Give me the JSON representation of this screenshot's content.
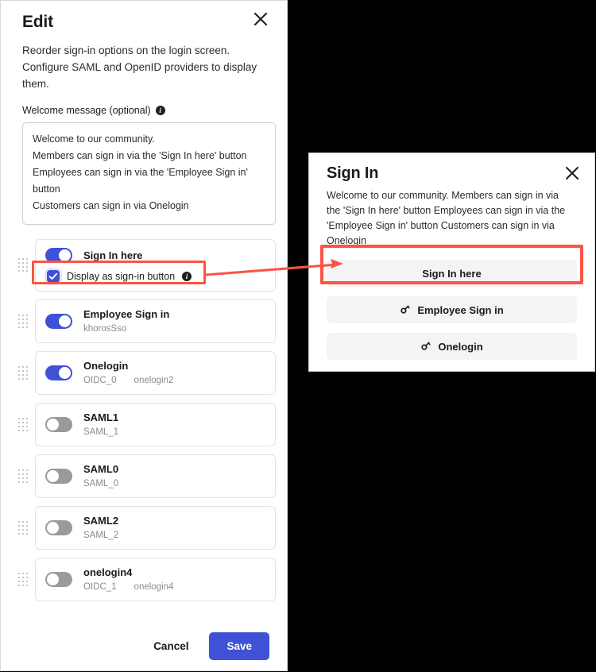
{
  "edit_dialog": {
    "title": "Edit",
    "close_icon": "close-icon",
    "description": "Reorder sign-in options on the login screen. Configure SAML and OpenID providers to display them.",
    "welcome_field": {
      "label": "Welcome message (optional)",
      "info_icon": "info-icon",
      "lines": [
        "Welcome to our community.",
        "Members can sign in via the 'Sign In here' button",
        "Employees can sign in via the 'Employee Sign in' button",
        "Customers can sign in via Onelogin"
      ]
    },
    "options": [
      {
        "title": "Sign In here",
        "enabled": true,
        "toggle_state": "on",
        "sub": [],
        "checkbox": {
          "label": "Display as sign-in button",
          "checked": true,
          "info_icon": "info-icon"
        }
      },
      {
        "title": "Employee Sign in",
        "enabled": true,
        "toggle_state": "on",
        "sub": [
          "khorosSso"
        ]
      },
      {
        "title": "Onelogin",
        "enabled": true,
        "toggle_state": "on",
        "sub": [
          "OIDC_0",
          "onelogin2"
        ]
      },
      {
        "title": "SAML1",
        "enabled": false,
        "toggle_state": "off",
        "sub": [
          "SAML_1"
        ]
      },
      {
        "title": "SAML0",
        "enabled": false,
        "toggle_state": "off",
        "sub": [
          "SAML_0"
        ]
      },
      {
        "title": "SAML2",
        "enabled": false,
        "toggle_state": "off",
        "sub": [
          "SAML_2"
        ]
      },
      {
        "title": "onelogin4",
        "enabled": false,
        "toggle_state": "off",
        "sub": [
          "OIDC_1",
          "onelogin4"
        ]
      }
    ],
    "footer": {
      "cancel_label": "Cancel",
      "save_label": "Save"
    }
  },
  "preview_dialog": {
    "title": "Sign In",
    "close_icon": "close-icon",
    "welcome_text": "Welcome to our community. Members can sign in via the 'Sign In here' button Employees can sign in via the 'Employee Sign in' button Customers can sign in via Onelogin",
    "buttons": [
      {
        "label": "Sign In here",
        "icon": null,
        "highlighted": true
      },
      {
        "label": "Employee Sign in",
        "icon": "key-icon",
        "highlighted": false
      },
      {
        "label": "Onelogin",
        "icon": "key-icon",
        "highlighted": false
      }
    ]
  },
  "annotation": {
    "highlight_color": "#fb5444",
    "arrow_icon": "arrow-right-icon"
  },
  "colors": {
    "accent": "#3f51d6",
    "toggle_on": "#3f51d6",
    "toggle_off": "#9a9a9a",
    "highlight": "#fb5444",
    "background": "#000000",
    "panel": "#ffffff"
  }
}
